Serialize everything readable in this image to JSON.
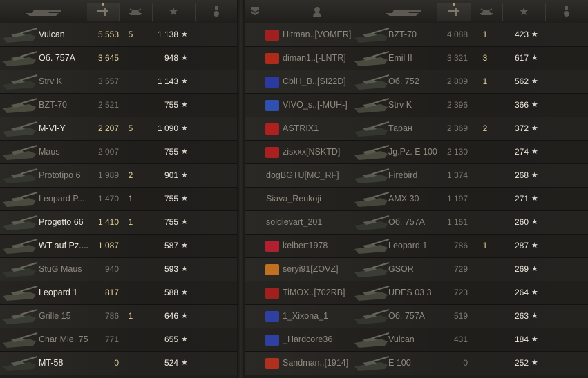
{
  "left": {
    "rows": [
      {
        "tank": "Vulcan",
        "damage": "5 553",
        "frags": "5",
        "xp": "1 138",
        "hl": true,
        "dmg_hl": true
      },
      {
        "tank": "Об. 757А",
        "damage": "3 645",
        "frags": "",
        "xp": "948",
        "hl": true,
        "dmg_hl": true
      },
      {
        "tank": "Strv K",
        "damage": "3 557",
        "frags": "",
        "xp": "1 143",
        "hl": false,
        "dmg_hl": false
      },
      {
        "tank": "BZT-70",
        "damage": "2 521",
        "frags": "",
        "xp": "755",
        "hl": false,
        "dmg_hl": false
      },
      {
        "tank": "M-VI-Y",
        "damage": "2 207",
        "frags": "5",
        "xp": "1 090",
        "hl": true,
        "dmg_hl": true
      },
      {
        "tank": "Maus",
        "damage": "2 007",
        "frags": "",
        "xp": "755",
        "hl": false,
        "dmg_hl": false
      },
      {
        "tank": "Prototipo 6",
        "damage": "1 989",
        "frags": "2",
        "xp": "901",
        "hl": false,
        "dmg_hl": false
      },
      {
        "tank": "Leopard P...",
        "damage": "1 470",
        "frags": "1",
        "xp": "755",
        "hl": false,
        "dmg_hl": false
      },
      {
        "tank": "Progetto 66",
        "damage": "1 410",
        "frags": "1",
        "xp": "755",
        "hl": true,
        "dmg_hl": true
      },
      {
        "tank": "WT auf Pz....",
        "damage": "1 087",
        "frags": "",
        "xp": "587",
        "hl": true,
        "dmg_hl": true
      },
      {
        "tank": "StuG Maus",
        "damage": "940",
        "frags": "",
        "xp": "593",
        "hl": false,
        "dmg_hl": false
      },
      {
        "tank": "Leopard 1",
        "damage": "817",
        "frags": "",
        "xp": "588",
        "hl": true,
        "dmg_hl": true
      },
      {
        "tank": "Grille 15",
        "damage": "786",
        "frags": "1",
        "xp": "646",
        "hl": false,
        "dmg_hl": false
      },
      {
        "tank": "Char Mle. 75",
        "damage": "771",
        "frags": "",
        "xp": "655",
        "hl": false,
        "dmg_hl": false
      },
      {
        "tank": "MT-58",
        "damage": "0",
        "frags": "",
        "xp": "524",
        "hl": true,
        "dmg_hl": true
      }
    ]
  },
  "right": {
    "rows": [
      {
        "player": "Hitman..[VOMER]",
        "badge": "#a02020",
        "tank": "BZT-70",
        "damage": "4 088",
        "frags": "1",
        "xp": "423"
      },
      {
        "player": "diman1..[-LNTR]",
        "badge": "#b02a1a",
        "tank": "Emil II",
        "damage": "3 321",
        "frags": "3",
        "xp": "617"
      },
      {
        "player": "CblH_B..[SI22D]",
        "badge": "#2a3aa0",
        "tank": "Об. 752",
        "damage": "2 809",
        "frags": "1",
        "xp": "562"
      },
      {
        "player": "VIVO_s..[-MUH-]",
        "badge": "#3050b0",
        "tank": "Strv K",
        "damage": "2 396",
        "frags": "",
        "xp": "366"
      },
      {
        "player": "ASTRIX1",
        "badge": "#b02020",
        "tank": "Таран",
        "damage": "2 369",
        "frags": "2",
        "xp": "372"
      },
      {
        "player": "zisxxx[NSKTD]",
        "badge": "#a82020",
        "tank": "Jg.Pz. E 100",
        "damage": "2 130",
        "frags": "",
        "xp": "274"
      },
      {
        "player": "dogBGTU[MC_RF]",
        "badge": "",
        "tank": "Firebird",
        "damage": "1 374",
        "frags": "",
        "xp": "268"
      },
      {
        "player": "Siava_Renkoji",
        "badge": "",
        "tank": "AMX 30",
        "damage": "1 197",
        "frags": "",
        "xp": "271"
      },
      {
        "player": "soldievart_201",
        "badge": "",
        "tank": "Об. 757А",
        "damage": "1 151",
        "frags": "",
        "xp": "260"
      },
      {
        "player": "kelbert1978",
        "badge": "#b02030",
        "tank": "Leopard 1",
        "damage": "786",
        "frags": "1",
        "xp": "287"
      },
      {
        "player": "seryi91[ZOVZ]",
        "badge": "#c07020",
        "tank": "GSOR",
        "damage": "729",
        "frags": "",
        "xp": "269"
      },
      {
        "player": "TiMOX..[702RB]",
        "badge": "#a02020",
        "tank": "UDES 03 3",
        "damage": "723",
        "frags": "",
        "xp": "264"
      },
      {
        "player": "1_Xixona_1",
        "badge": "#3040a0",
        "tank": "Об. 757А",
        "damage": "519",
        "frags": "",
        "xp": "263"
      },
      {
        "player": "_Hardcore36",
        "badge": "#3040a0",
        "tank": "Vulcan",
        "damage": "431",
        "frags": "",
        "xp": "184"
      },
      {
        "player": "Sandman..[1914]",
        "badge": "#b03020",
        "tank": "E 100",
        "damage": "0",
        "frags": "",
        "xp": "252"
      }
    ]
  },
  "colors": {
    "accent": "#e3cf96",
    "text": "#c8c4b8",
    "muted": "#8d897e"
  },
  "icons": {
    "tank": "tank-icon",
    "damage": "damage-icon",
    "frags": "frags-icon",
    "xp": "xp-star-icon",
    "medal": "medal-icon",
    "platoon": "platoon-icon",
    "player": "player-icon",
    "star": "★"
  }
}
